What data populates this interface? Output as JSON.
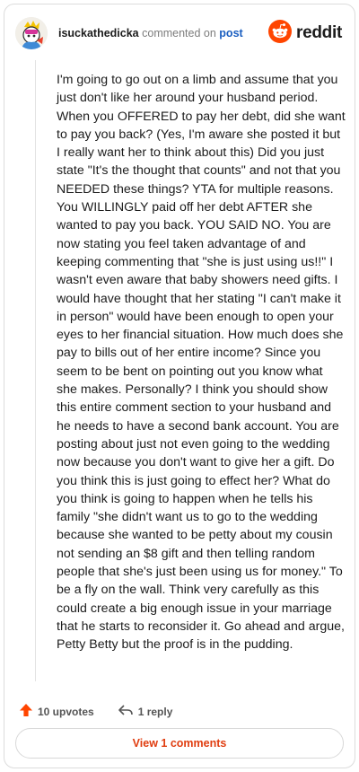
{
  "header": {
    "username": "isuckathedicka",
    "action_text": "commented on",
    "post_link": "post",
    "brand": "reddit",
    "avatar_icon": "snoo-avatar-icon",
    "logo_icon": "reddit-alien-icon"
  },
  "comment": {
    "body": "I'm going to go out on a limb and assume that you just don't like her around your husband period. When you OFFERED to pay her debt, did she want to pay you back? (Yes, I'm aware she posted it but I really want her to think about this) Did you just state \"It's the thought that counts\" and not that you NEEDED these things? YTA for multiple reasons. You WILLINGLY paid off her debt AFTER she wanted to pay you back. YOU SAID NO. You are now stating you feel taken advantage of and keeping commenting that \"she is just using us!!\" I wasn't even aware that baby showers need gifts. I would have thought that her stating \"I can't make it in person\" would have been enough to open your eyes to her financial situation. How much does she pay to bills out of her entire income? Since you seem to be bent on pointing out you know what she makes. Personally? I think you should show this entire comment section to your husband and he needs to have a second bank account. You are posting about just not even going to the wedding now because you don't want to give her a gift. Do you think this is just going to effect her? What do you think is going to happen when he tells his family \"she didn't want us to go to the wedding because she wanted to be petty about my cousin not sending an $8 gift and then telling random people that she's just been using us for money.\" To be a fly on the wall. Think very carefully as this could create a big enough issue in your marriage that he starts to reconsider it. Go ahead and argue, Petty Betty but the proof is in the pudding."
  },
  "actions": {
    "upvotes_label": "10 upvotes",
    "reply_label": "1 reply",
    "upvote_icon": "upvote-arrow-icon",
    "reply_icon": "reply-arrow-icon"
  },
  "footer": {
    "view_comments_label": "View 1 comments"
  },
  "colors": {
    "brand_orange": "#ff4500",
    "link_blue": "#1a5ec0",
    "view_button_text": "#e03d10"
  }
}
